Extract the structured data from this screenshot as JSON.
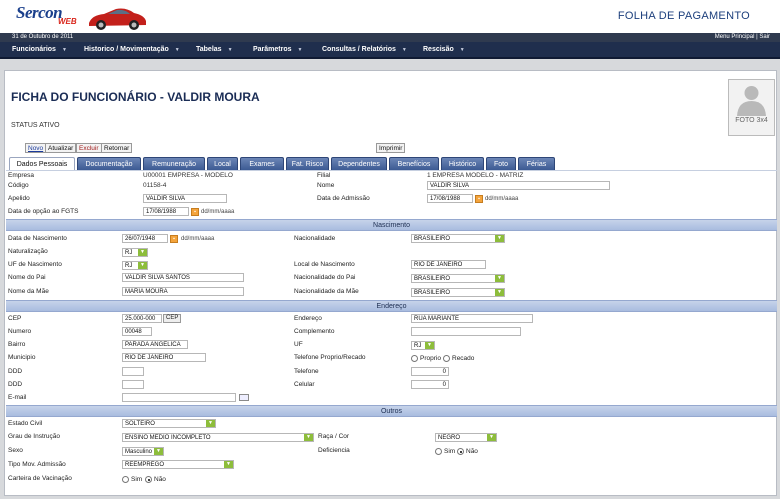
{
  "app": {
    "brand": "Sercon",
    "brand_sub": "WEB",
    "title": "FOLHA DE PAGAMENTO",
    "date": "31 de Outubro de 2011",
    "links": "Menu Principal | Sair"
  },
  "nav": [
    "Funcionários",
    "Historico / Movimentação",
    "Tabelas",
    "Parâmetros",
    "Consultas / Relatórios",
    "Rescisão"
  ],
  "page": {
    "title": "FICHA DO FUNCIONÁRIO - VALDIR MOURA",
    "status": "STATUS ATIVO",
    "photo": "FOTO 3x4"
  },
  "actions": {
    "novo": "Novo",
    "atualizar": "Atualizar",
    "excluir": "Excluir",
    "retornar": "Retornar",
    "imprimir": "Imprimir"
  },
  "tabs": [
    "Dados Pessoais",
    "Documentação",
    "Remuneração",
    "Local",
    "Exames",
    "Fat. Risco",
    "Dependentes",
    "Benefícios",
    "Histórico",
    "Foto",
    "Férias"
  ],
  "dados": {
    "empresa_l": "Empresa",
    "empresa_v": "U00001 EMPRESA - MODELO",
    "filial_l": "Filial",
    "filial_v": "1 EMPRESA MODELO - MATRIZ",
    "codigo_l": "Código",
    "codigo_v": "01158-4",
    "nome_l": "Nome",
    "nome_v": "VALDIR SILVA",
    "apelido_l": "Apelido",
    "apelido_v": "VALDIR SILVA",
    "admissao_l": "Data de Admissão",
    "admissao_v": "17/08/1988",
    "fgts_l": "Data de opção ao FGTS",
    "fgts_v": "17/08/1988",
    "fmt": "dd/mm/aaaa"
  },
  "nascimento": {
    "section": "Nascimento",
    "data_l": "Data de Nascimento",
    "data_v": "26/07/1948",
    "nacionalidade_l": "Nacionalidade",
    "nacionalidade_v": "BRASILEIRO",
    "naturalizacao_l": "Naturalização",
    "naturalizacao_v": "RJ",
    "uf_l": "UF de Nascimento",
    "uf_v": "RJ",
    "local_l": "Local de Nascimento",
    "local_v": "RIO DE JANEIRO",
    "pai_l": "Nome do Pai",
    "pai_v": "VALDIR SILVA SANTOS",
    "nacpai_l": "Nacionalidade do Pai",
    "nacpai_v": "BRASILEIRO",
    "mae_l": "Nome da Mãe",
    "mae_v": "MARIA MOURA",
    "nacmae_l": "Nacionalidade da Mãe",
    "nacmae_v": "BRASILEIRO"
  },
  "endereco": {
    "section": "Endereço",
    "cep_l": "CEP",
    "cep_v": "25.000-000",
    "cep_btn": "CEP",
    "end_l": "Endereço",
    "end_v": "RUA MARIANTE",
    "numero_l": "Numero",
    "numero_v": "00048",
    "compl_l": "Complemento",
    "compl_v": "",
    "bairro_l": "Bairro",
    "bairro_v": "PARADA ANGELICA",
    "uf_l": "UF",
    "uf_v": "RJ",
    "municipio_l": "Municipio",
    "municipio_v": "RIO DE JANEIRO",
    "telrec_l": "Telefone Proprio/Recado",
    "proprio": "Proprio",
    "recado": "Recado",
    "ddd_l": "DDD",
    "tel_l": "Telefone",
    "tel_v": "0",
    "ddd2_l": "DDD",
    "cel_l": "Celular",
    "cel_v": "0",
    "email_l": "E-mail"
  },
  "outros": {
    "section": "Outros",
    "civil_l": "Estado Civil",
    "civil_v": "SOLTEIRO",
    "grau_l": "Grau de Instrução",
    "grau_v": "ENSINO MEDIO INCOMPLETO",
    "raca_l": "Raça / Cor",
    "raca_v": "NEGRO",
    "sexo_l": "Sexo",
    "sexo_v": "Masculino",
    "defic_l": "Deficiencia",
    "sim": "Sim",
    "nao": "Não",
    "tipo_l": "Tipo Mov. Admissão",
    "tipo_v": "REEMPREGO",
    "vac_l": "Carteira de Vacinação"
  }
}
